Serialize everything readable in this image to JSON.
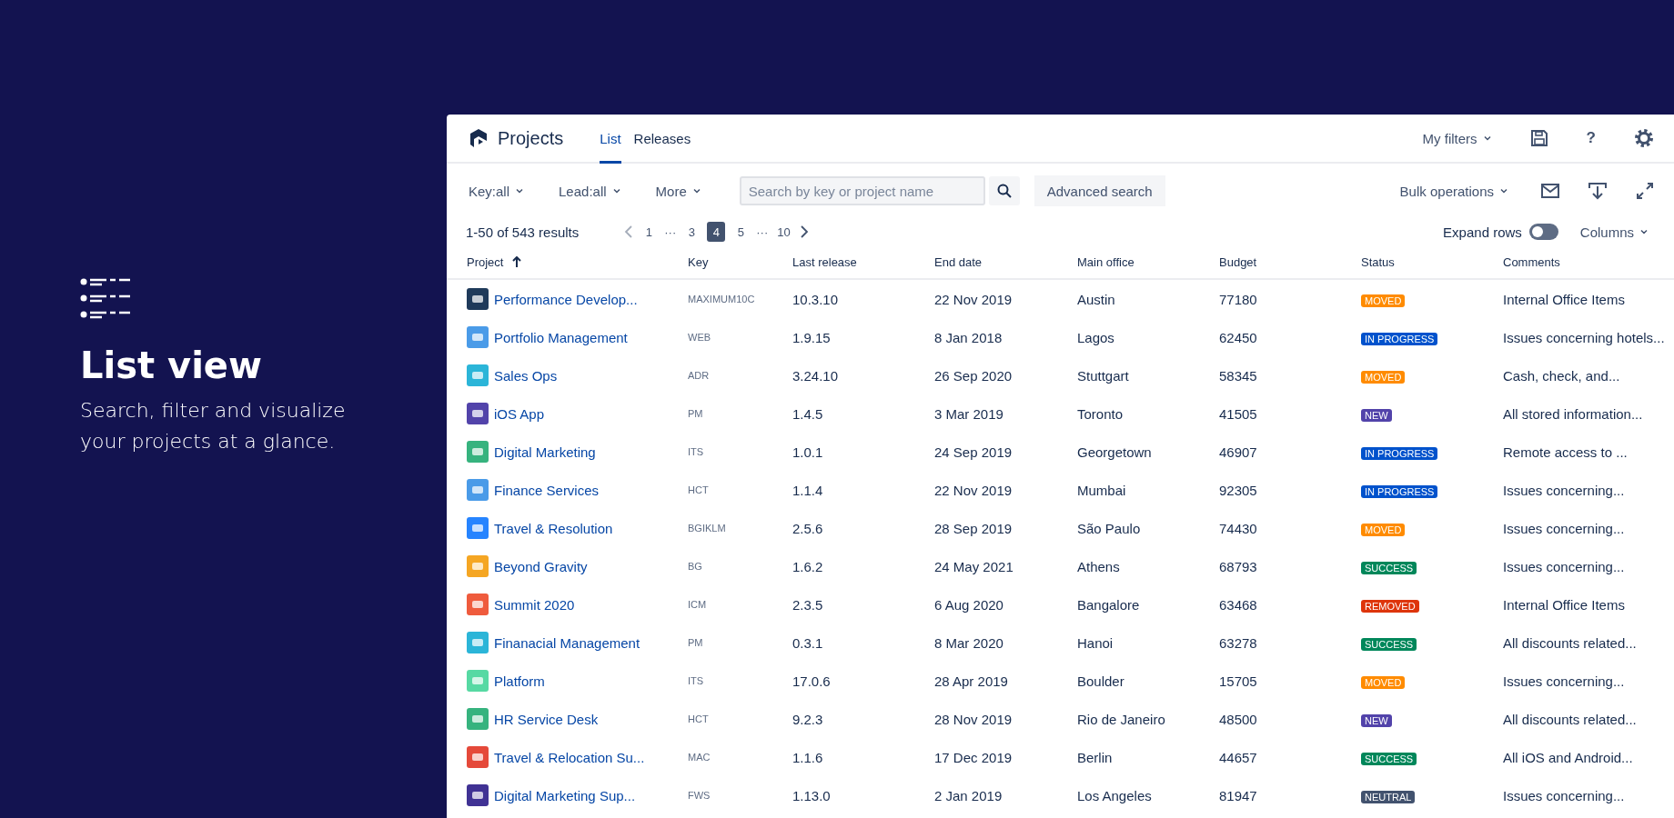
{
  "promo": {
    "title": "List view",
    "subtitle": "Search, filter and visualize your projects at a glance."
  },
  "header": {
    "title": "Projects",
    "tabs": [
      {
        "label": "List",
        "selected": true
      },
      {
        "label": "Releases",
        "selected": false
      }
    ],
    "my_filters": "My filters",
    "help": "?"
  },
  "toolbar": {
    "filters": [
      "Key:all",
      "Lead:all",
      "More"
    ],
    "search": {
      "placeholder": "Search by key or project name"
    },
    "advanced_search": "Advanced search",
    "bulk_operations": "Bulk operations"
  },
  "results": {
    "summary": "1-50 of 543 results",
    "prev_disabled": true,
    "pages": [
      {
        "label": "1",
        "kind": "page",
        "selected": false
      },
      {
        "label": "···",
        "kind": "ellipsis"
      },
      {
        "label": "3",
        "kind": "page",
        "selected": false
      },
      {
        "label": "4",
        "kind": "page",
        "selected": true
      },
      {
        "label": "5",
        "kind": "page",
        "selected": false
      },
      {
        "label": "···",
        "kind": "ellipsis"
      },
      {
        "label": "10",
        "kind": "page",
        "selected": false
      }
    ],
    "expand_rows": {
      "label": "Expand rows",
      "on": false
    },
    "columns_button": "Columns"
  },
  "table": {
    "columns": [
      {
        "label": "Project",
        "sorted": true
      },
      {
        "label": "Key",
        "sorted": false
      },
      {
        "label": "Last release",
        "sorted": false
      },
      {
        "label": "End date",
        "sorted": false
      },
      {
        "label": "Main office",
        "sorted": false
      },
      {
        "label": "Budget",
        "sorted": false
      },
      {
        "label": "Status",
        "sorted": false
      },
      {
        "label": "Comments",
        "sorted": false
      }
    ],
    "rows": [
      {
        "project": "Performance Develop...",
        "icon": {
          "color": "#1f3a5a"
        },
        "key": "MAXIMUM10C",
        "last_release": "10.3.10",
        "end_date": "22 Nov 2019",
        "main_office": "Austin",
        "budget": "77180",
        "status": {
          "label": "MOVED",
          "color": "#ff8b00"
        },
        "comments": "Internal Office Items"
      },
      {
        "project": "Portfolio Management",
        "icon": {
          "color": "#4a9be8"
        },
        "key": "WEB",
        "last_release": "1.9.15",
        "end_date": "8 Jan 2018",
        "main_office": "Lagos",
        "budget": "62450",
        "status": {
          "label": "IN PROGRESS",
          "color": "#0052cc"
        },
        "comments": "Issues concerning hotels..."
      },
      {
        "project": "Sales Ops",
        "icon": {
          "color": "#2bb5d8"
        },
        "key": "ADR",
        "last_release": "3.24.10",
        "end_date": "26 Sep 2020",
        "main_office": "Stuttgart",
        "budget": "58345",
        "status": {
          "label": "MOVED",
          "color": "#ff8b00"
        },
        "comments": "Cash, check, and..."
      },
      {
        "project": "iOS App",
        "icon": {
          "color": "#5243aa"
        },
        "key": "PM",
        "last_release": "1.4.5",
        "end_date": "3 Mar 2019",
        "main_office": "Toronto",
        "budget": "41505",
        "status": {
          "label": "NEW",
          "color": "#5243aa"
        },
        "comments": "All stored information..."
      },
      {
        "project": "Digital Marketing",
        "icon": {
          "color": "#36b37e"
        },
        "key": "ITS",
        "last_release": "1.0.1",
        "end_date": "24 Sep 2019",
        "main_office": "Georgetown",
        "budget": "46907",
        "status": {
          "label": "IN PROGRESS",
          "color": "#0052cc"
        },
        "comments": "Remote access to ..."
      },
      {
        "project": "Finance Services",
        "icon": {
          "color": "#4a9be8"
        },
        "key": "HCT",
        "last_release": "1.1.4",
        "end_date": "22 Nov 2019",
        "main_office": "Mumbai",
        "budget": "92305",
        "status": {
          "label": "IN PROGRESS",
          "color": "#0052cc"
        },
        "comments": "Issues concerning..."
      },
      {
        "project": "Travel & Resolution",
        "icon": {
          "color": "#2684ff"
        },
        "key": "BGIKLM",
        "last_release": "2.5.6",
        "end_date": "28 Sep 2019",
        "main_office": "São Paulo",
        "budget": "74430",
        "status": {
          "label": "MOVED",
          "color": "#ff8b00"
        },
        "comments": "Issues concerning..."
      },
      {
        "project": "Beyond Gravity",
        "icon": {
          "color": "#f5a623"
        },
        "key": "BG",
        "last_release": "1.6.2",
        "end_date": "24 May 2021",
        "main_office": "Athens",
        "budget": "68793",
        "status": {
          "label": "SUCCESS",
          "color": "#00875a"
        },
        "comments": "Issues concerning..."
      },
      {
        "project": "Summit 2020",
        "icon": {
          "color": "#ef5b3d"
        },
        "key": "ICM",
        "last_release": "2.3.5",
        "end_date": "6 Aug 2020",
        "main_office": "Bangalore",
        "budget": "63468",
        "status": {
          "label": "REMOVED",
          "color": "#de350b"
        },
        "comments": "Internal Office Items"
      },
      {
        "project": "Finanacial Management",
        "icon": {
          "color": "#2bb5d8"
        },
        "key": "PM",
        "last_release": "0.3.1",
        "end_date": "8 Mar 2020",
        "main_office": "Hanoi",
        "budget": "63278",
        "status": {
          "label": "SUCCESS",
          "color": "#00875a"
        },
        "comments": "All discounts related..."
      },
      {
        "project": "Platform",
        "icon": {
          "color": "#57d9a3"
        },
        "key": "ITS",
        "last_release": "17.0.6",
        "end_date": "28 Apr 2019",
        "main_office": "Boulder",
        "budget": "15705",
        "status": {
          "label": "MOVED",
          "color": "#ff8b00"
        },
        "comments": "Issues concerning..."
      },
      {
        "project": "HR Service Desk",
        "icon": {
          "color": "#36b37e"
        },
        "key": "HCT",
        "last_release": "9.2.3",
        "end_date": "28 Nov 2019",
        "main_office": "Rio de Janeiro",
        "budget": "48500",
        "status": {
          "label": "NEW",
          "color": "#5243aa"
        },
        "comments": "All discounts related..."
      },
      {
        "project": "Travel & Relocation Su...",
        "icon": {
          "color": "#e5493a"
        },
        "key": "MAC",
        "last_release": "1.1.6",
        "end_date": "17 Dec 2019",
        "main_office": "Berlin",
        "budget": "44657",
        "status": {
          "label": "SUCCESS",
          "color": "#00875a"
        },
        "comments": "All iOS and Android..."
      },
      {
        "project": "Digital Marketing Sup...",
        "icon": {
          "color": "#403294"
        },
        "key": "FWS",
        "last_release": "1.13.0",
        "end_date": "2 Jan 2019",
        "main_office": "Los Angeles",
        "budget": "81947",
        "status": {
          "label": "NEUTRAL",
          "color": "#42526e"
        },
        "comments": "Issues concerning..."
      }
    ]
  }
}
